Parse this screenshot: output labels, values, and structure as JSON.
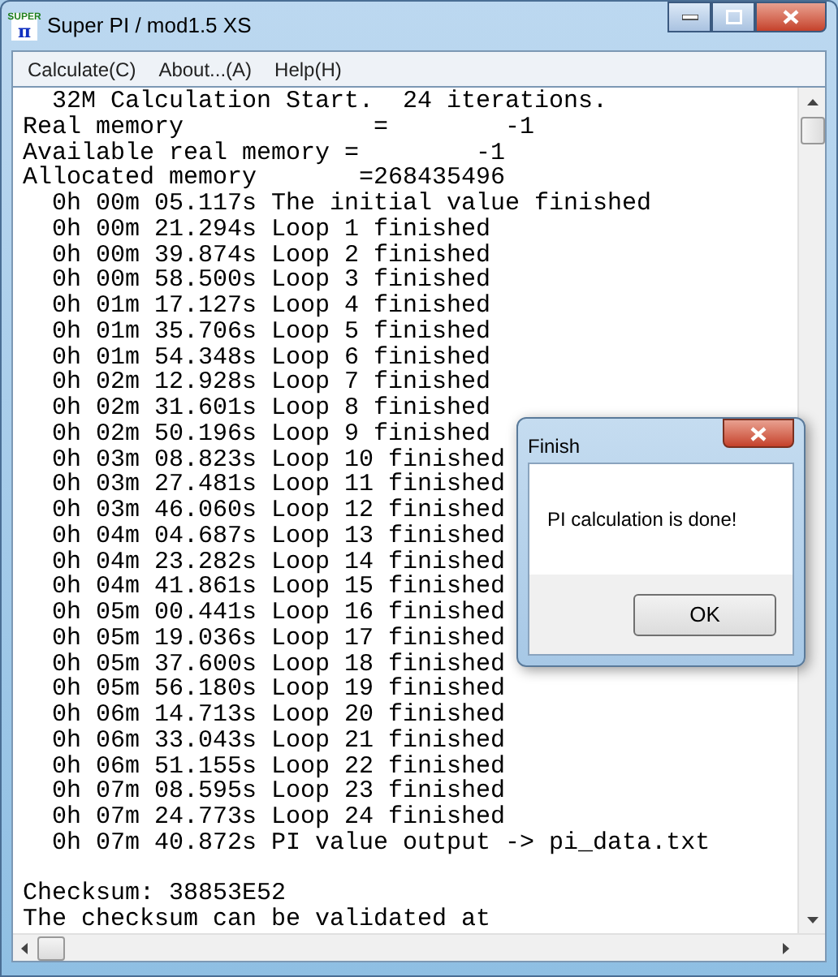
{
  "window": {
    "title": "Super PI / mod1.5 XS",
    "logo_top": "SUPER",
    "logo_bottom": "π"
  },
  "menu": [
    {
      "label": "Calculate(C)"
    },
    {
      "label": "About...(A)"
    },
    {
      "label": "Help(H)"
    }
  ],
  "log": [
    "  32M Calculation Start.  24 iterations.",
    "Real memory             =        -1",
    "Available real memory =        -1",
    "Allocated memory       =268435496",
    "  0h 00m 05.117s The initial value finished",
    "  0h 00m 21.294s Loop 1 finished",
    "  0h 00m 39.874s Loop 2 finished",
    "  0h 00m 58.500s Loop 3 finished",
    "  0h 01m 17.127s Loop 4 finished",
    "  0h 01m 35.706s Loop 5 finished",
    "  0h 01m 54.348s Loop 6 finished",
    "  0h 02m 12.928s Loop 7 finished",
    "  0h 02m 31.601s Loop 8 finished",
    "  0h 02m 50.196s Loop 9 finished",
    "  0h 03m 08.823s Loop 10 finished",
    "  0h 03m 27.481s Loop 11 finished",
    "  0h 03m 46.060s Loop 12 finished",
    "  0h 04m 04.687s Loop 13 finished",
    "  0h 04m 23.282s Loop 14 finished",
    "  0h 04m 41.861s Loop 15 finished",
    "  0h 05m 00.441s Loop 16 finished",
    "  0h 05m 19.036s Loop 17 finished",
    "  0h 05m 37.600s Loop 18 finished",
    "  0h 05m 56.180s Loop 19 finished",
    "  0h 06m 14.713s Loop 20 finished",
    "  0h 06m 33.043s Loop 21 finished",
    "  0h 06m 51.155s Loop 22 finished",
    "  0h 07m 08.595s Loop 23 finished",
    "  0h 07m 24.773s Loop 24 finished",
    "  0h 07m 40.872s PI value output -> pi_data.txt"
  ],
  "footer": [
    "Checksum: 38853E52",
    "The checksum can be validated at"
  ],
  "dialog": {
    "title": "Finish",
    "message": "PI calculation is done!",
    "button": "OK"
  }
}
